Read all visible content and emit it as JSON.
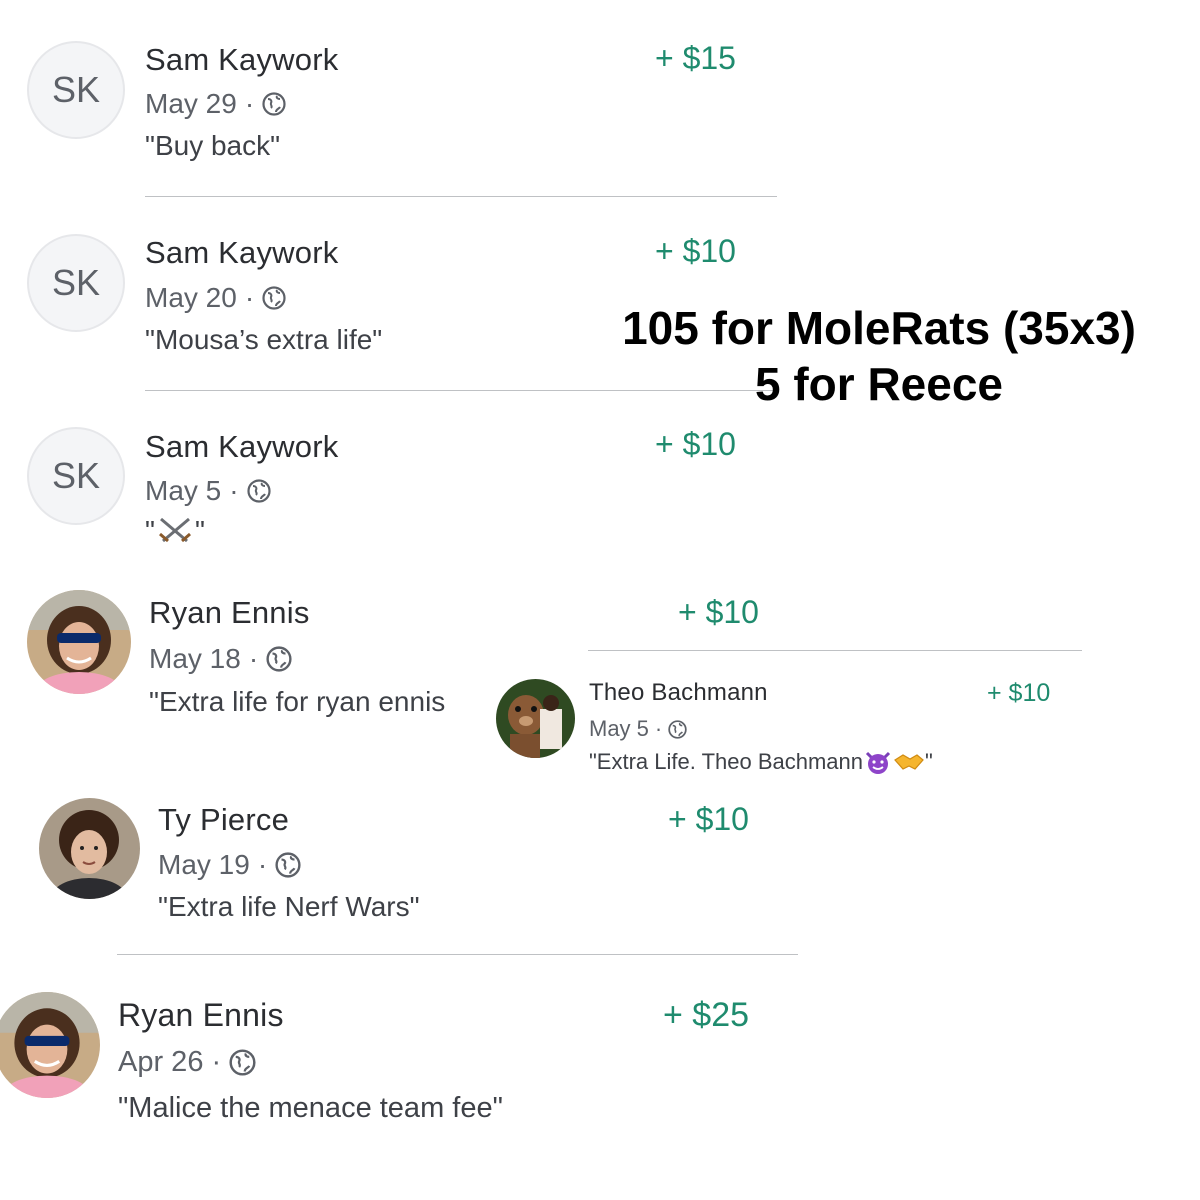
{
  "transactions": [
    {
      "name": "Sam Kaywork",
      "initials": "SK",
      "date": "May 29",
      "note": "\"Buy back\"",
      "amount": "+ $15"
    },
    {
      "name": "Sam Kaywork",
      "initials": "SK",
      "date": "May 20",
      "note": "\"Mousa’s extra life\"",
      "amount": "+ $10"
    },
    {
      "name": "Sam Kaywork",
      "initials": "SK",
      "date": "May 5",
      "note_prefix": "\"",
      "note_suffix": "\"",
      "note_icon": "crossed-swords-icon",
      "amount": "+ $10"
    },
    {
      "name": "Ryan Ennis",
      "date": "May 18",
      "note": "\"Extra life for ryan ennis",
      "amount": "+ $10"
    },
    {
      "name": "Theo Bachmann",
      "date": "May 5",
      "note": "\"Extra Life. Theo Bachmann",
      "note_end": "\"",
      "note_icons": [
        "smiling-devil-icon",
        "handshake-icon"
      ],
      "amount": "+ $10"
    },
    {
      "name": "Ty Pierce",
      "date": "May 19",
      "note": "\"Extra life Nerf Wars\"",
      "amount": "+ $10"
    },
    {
      "name": "Ryan Ennis",
      "date": "Apr 26",
      "note": "\"Malice the menace team fee\"",
      "amount": "+ $25"
    }
  ],
  "separator": "·",
  "overlay": {
    "line1": "105 for MoleRats (35x3)",
    "line2": "5 for Reece"
  },
  "colors": {
    "amount": "#1f8b6e",
    "text": "#2b2d31",
    "meta": "#5d6168"
  }
}
